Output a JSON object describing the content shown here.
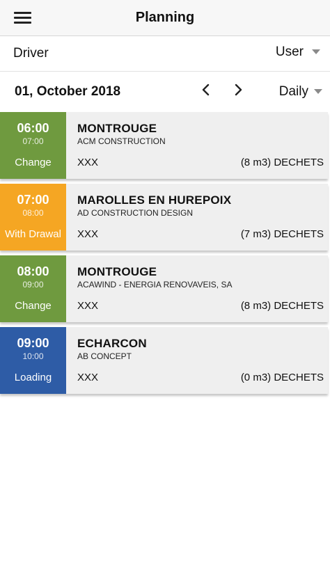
{
  "header": {
    "title": "Planning"
  },
  "filter": {
    "label": "Driver",
    "user_value": "User"
  },
  "date_bar": {
    "date": "01, October 2018",
    "period": "Daily"
  },
  "colors": {
    "green": "#6f9a3f",
    "orange": "#f5a623",
    "blue": "#2e5ca6"
  },
  "schedule": [
    {
      "start": "06:00",
      "end": "07:00",
      "status": "Change",
      "status_color": "green",
      "city": "MONTROUGE",
      "company": "ACM CONSTRUCTION",
      "ref": "XXX",
      "waste": "(8 m3) DECHETS"
    },
    {
      "start": "07:00",
      "end": "08:00",
      "status": "With Drawal",
      "status_color": "orange",
      "city": "MAROLLES EN HUREPOIX",
      "company": "AD CONSTRUCTION DESIGN",
      "ref": "XXX",
      "waste": "(7 m3) DECHETS"
    },
    {
      "start": "08:00",
      "end": "09:00",
      "status": "Change",
      "status_color": "green",
      "city": "MONTROUGE",
      "company": "ACAWIND - ENERGIA RENOVAVEIS, SA",
      "ref": "XXX",
      "waste": "(8 m3) DECHETS"
    },
    {
      "start": "09:00",
      "end": "10:00",
      "status": "Loading",
      "status_color": "blue",
      "city": "ECHARCON",
      "company": "AB CONCEPT",
      "ref": "XXX",
      "waste": "(0 m3) DECHETS"
    }
  ]
}
